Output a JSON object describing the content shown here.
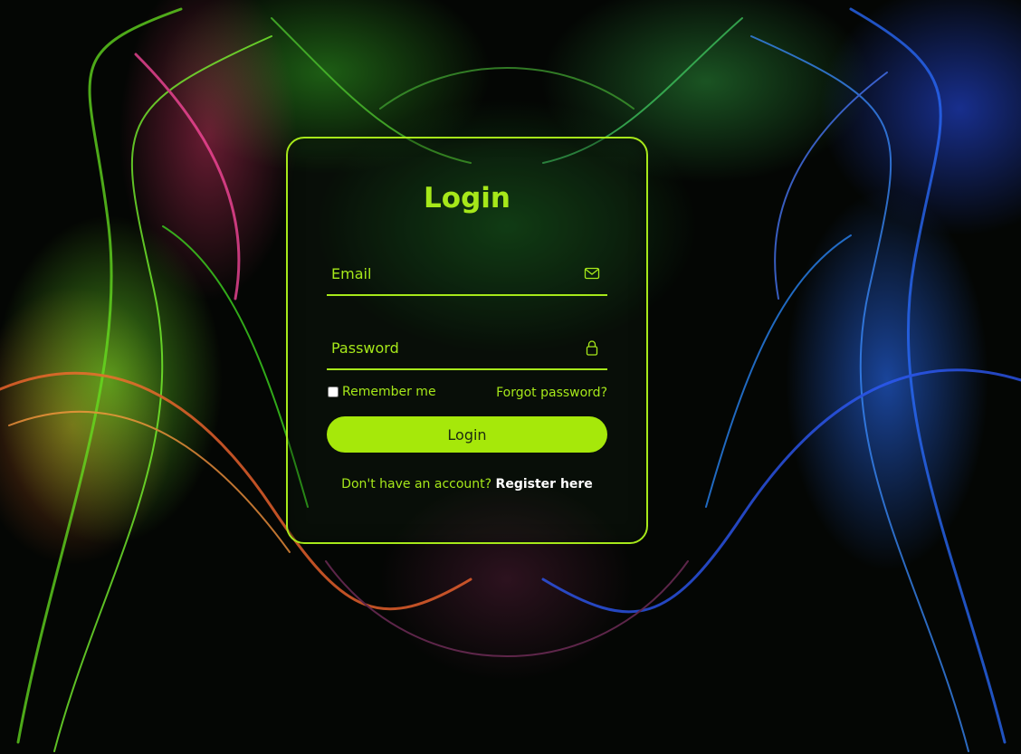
{
  "login": {
    "title": "Login",
    "email": {
      "placeholder": "Email",
      "value": "",
      "icon": "mail-icon"
    },
    "password": {
      "placeholder": "Password",
      "value": "",
      "icon": "lock-icon"
    },
    "remember_label": "Remember me",
    "forgot_label": "Forgot password?",
    "submit_label": "Login",
    "register_prompt": "Don't have an account?",
    "register_link": "Register here"
  },
  "colors": {
    "accent": "#a6e81a",
    "button_text": "#1c2a10",
    "link_highlight": "#ffffff"
  }
}
